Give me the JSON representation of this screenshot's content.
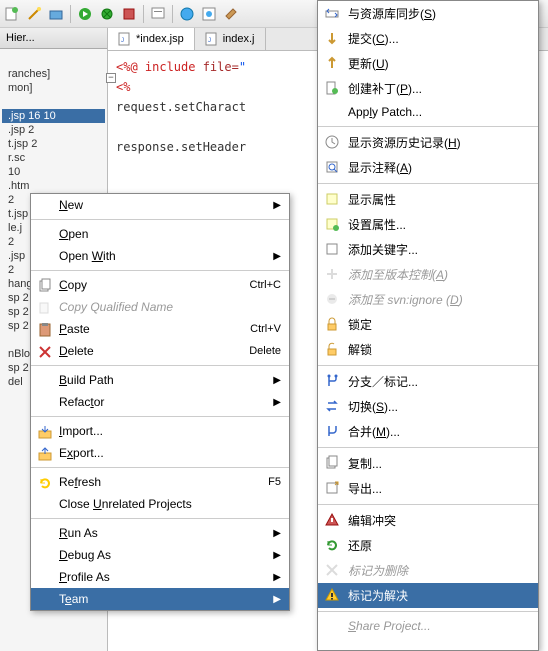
{
  "toolbar_icons": [
    "new",
    "wizard",
    "box",
    "run",
    "debug",
    "external",
    "search",
    "globe",
    "browser",
    "paint"
  ],
  "left_panel": {
    "title": "Hier..."
  },
  "tree": {
    "items": [
      "",
      "ranches]",
      "mon]",
      "",
      ".jsp 16  10",
      ".jsp 2",
      "t.jsp 2",
      "r.sc",
      "   10",
      ".htm",
      "   2",
      "t.jsp",
      "le.j",
      "  2",
      ".jsp",
      "  2",
      "hang",
      "sp 2",
      "sp 2",
      "sp 2",
      "",
      "nBlo",
      "sp 2",
      "  del"
    ],
    "selected_index": 4
  },
  "editor": {
    "tabs": [
      {
        "label": "*index.jsp",
        "active": true
      },
      {
        "label": "index.j",
        "active": false
      }
    ],
    "lines": [
      {
        "pre": "<%@ ",
        "kw": "include ",
        "attr": "file=",
        "str": "\""
      },
      {
        "pre": "<%",
        "kw": "",
        "attr": "",
        "str": ""
      },
      {
        "pre": "  request.setCharact",
        "kw": "",
        "attr": "",
        "str": ""
      },
      {
        "pre": "",
        "kw": "",
        "attr": "",
        "str": ""
      },
      {
        "pre": "  response.setHeader",
        "kw": "",
        "attr": "",
        "str": ""
      }
    ]
  },
  "context_menu": {
    "items": [
      {
        "label": "New",
        "u": "N",
        "sub": true
      },
      {
        "sep": true
      },
      {
        "label": "Open",
        "u": "O"
      },
      {
        "label": "Open With",
        "u": "W",
        "sub": true
      },
      {
        "sep": true
      },
      {
        "label": "Copy",
        "u": "C",
        "shortcut": "Ctrl+C",
        "icon": "copy"
      },
      {
        "label": "Copy Qualified Name",
        "disabled": true,
        "icon": "copyq"
      },
      {
        "label": "Paste",
        "u": "P",
        "shortcut": "Ctrl+V",
        "icon": "paste"
      },
      {
        "label": "Delete",
        "u": "D",
        "shortcut": "Delete",
        "icon": "delete"
      },
      {
        "sep": true
      },
      {
        "label": "Build Path",
        "u": "B",
        "sub": true
      },
      {
        "label": "Refactor",
        "u": "t",
        "sub": true
      },
      {
        "sep": true
      },
      {
        "label": "Import...",
        "u": "I",
        "icon": "import"
      },
      {
        "label": "Export...",
        "u": "x",
        "icon": "export"
      },
      {
        "sep": true
      },
      {
        "label": "Refresh",
        "u": "f",
        "shortcut": "F5",
        "icon": "refresh"
      },
      {
        "label": "Close Unrelated Projects",
        "u": "U"
      },
      {
        "sep": true
      },
      {
        "label": "Run As",
        "u": "R",
        "sub": true
      },
      {
        "label": "Debug As",
        "u": "D",
        "sub": true
      },
      {
        "label": "Profile As",
        "u": "P",
        "sub": true
      },
      {
        "label": "Team",
        "u": "e",
        "sub": true,
        "highlight": true
      }
    ]
  },
  "sub_menu": {
    "items": [
      {
        "label": "与资源库同步(S)",
        "u": "S",
        "icon": "sync"
      },
      {
        "label": "提交(C)...",
        "u": "C",
        "icon": "commit"
      },
      {
        "label": "更新(U)",
        "u": "U",
        "icon": "update"
      },
      {
        "label": "创建补丁(P)...",
        "u": "P",
        "icon": "patch"
      },
      {
        "label": "Apply Patch...",
        "u": "l"
      },
      {
        "sep": true
      },
      {
        "label": "显示资源历史记录(H)",
        "u": "H",
        "icon": "history"
      },
      {
        "label": "显示注释(A)",
        "u": "A",
        "icon": "annotate"
      },
      {
        "sep": true
      },
      {
        "label": "显示属性",
        "icon": "props"
      },
      {
        "label": "设置属性...",
        "icon": "setprops"
      },
      {
        "label": "添加关键字...",
        "icon": "addkw"
      },
      {
        "label": "添加至版本控制(A)",
        "u": "A",
        "disabled": true,
        "icon": "addvc"
      },
      {
        "label": "添加至 svn:ignore (D)",
        "u": "D",
        "disabled": true,
        "icon": "ignore"
      },
      {
        "label": "锁定",
        "icon": "lock"
      },
      {
        "label": "解锁",
        "icon": "unlock"
      },
      {
        "sep": true
      },
      {
        "label": "分支／标记...",
        "icon": "branch"
      },
      {
        "label": "切换(S)...",
        "u": "S",
        "icon": "switch"
      },
      {
        "label": "合并(M)...",
        "u": "M",
        "icon": "merge"
      },
      {
        "sep": true
      },
      {
        "label": "复制...",
        "icon": "cp"
      },
      {
        "label": "导出...",
        "icon": "exp"
      },
      {
        "sep": true
      },
      {
        "label": "编辑冲突",
        "icon": "conflict"
      },
      {
        "label": "还原",
        "icon": "revert"
      },
      {
        "label": "标记为删除",
        "disabled": true,
        "icon": "markdel"
      },
      {
        "label": "标记为解决",
        "highlight": true,
        "icon": "resolve"
      },
      {
        "sep": true
      },
      {
        "label": "Share Project...",
        "u": "S",
        "disabled": true
      }
    ]
  }
}
